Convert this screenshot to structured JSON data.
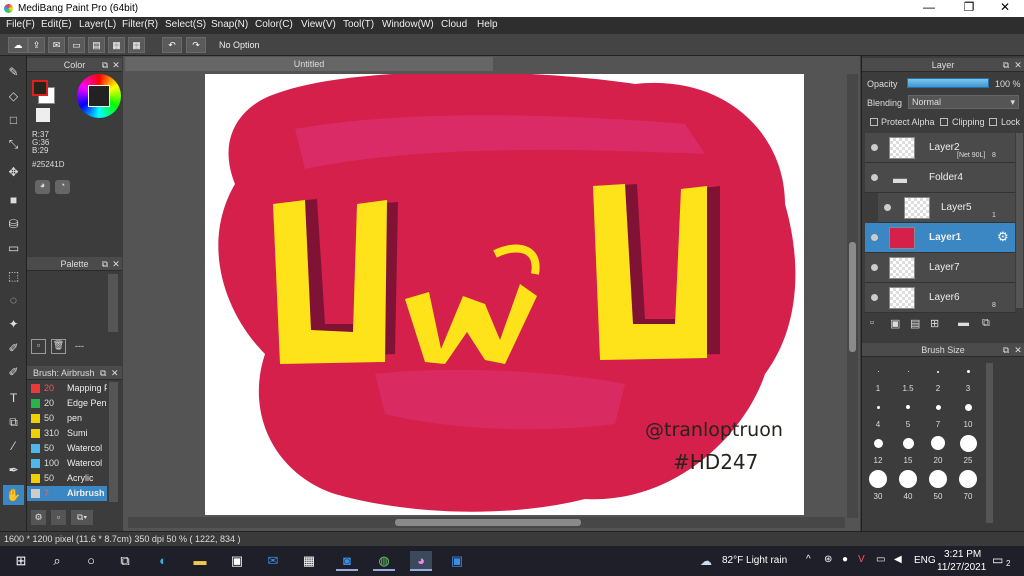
{
  "app": {
    "title": "MediBang Paint Pro (64bit)"
  },
  "window_controls": {
    "minimize": "—",
    "maximize": "❐",
    "close": "✕"
  },
  "menu": [
    "File(F)",
    "Edit(E)",
    "Layer(L)",
    "Filter(R)",
    "Select(S)",
    "Snap(N)",
    "Color(C)",
    "View(V)",
    "Tool(T)",
    "Window(W)",
    "Cloud",
    "Help"
  ],
  "toolbar": {
    "option_text": "No Option"
  },
  "document": {
    "tab_title": "Untitled"
  },
  "color_panel": {
    "title": "Color",
    "r": "R:37",
    "g": "G:36",
    "b": "B:29",
    "hex": "#25241D",
    "foreground": "#25241d",
    "background": "#ffffff",
    "accent_swatch": "#dd1f1f"
  },
  "palette_panel": {
    "title": "Palette",
    "footer": "---"
  },
  "brush_panel": {
    "title": "Brush: Airbrush",
    "items": [
      {
        "size": "20",
        "name": "Mapping P",
        "color": "#e83a3a"
      },
      {
        "size": "20",
        "name": "Edge Pen",
        "color": "#2bb24c"
      },
      {
        "size": "50",
        "name": "pen",
        "color": "#f0d000"
      },
      {
        "size": "310",
        "name": "Sumi",
        "color": "#f0d000"
      },
      {
        "size": "50",
        "name": "Watercol",
        "color": "#4fb8e8"
      },
      {
        "size": "100",
        "name": "Watercol",
        "color": "#4fb8e8"
      },
      {
        "size": "50",
        "name": "Acrylic",
        "color": "#f0d000"
      },
      {
        "size": "7",
        "name": "Airbrush",
        "color": "#cccccc"
      }
    ],
    "selected_index": 7
  },
  "canvas_art": {
    "main_text": "UwU",
    "signature": "@tranloptruon",
    "tag": "#HD247",
    "blob_color": "#d4204a",
    "letter_color": "#ffe31a"
  },
  "layer_panel": {
    "title": "Layer",
    "opacity_label": "Opacity",
    "opacity_value": "100 %",
    "blending_label": "Blending",
    "blending_value": "Normal",
    "protect_alpha": "Protect Alpha",
    "clipping": "Clipping",
    "lock": "Lock",
    "layers": [
      {
        "name": "Layer2",
        "badge": "[Net 90L]",
        "num": "8"
      },
      {
        "name": "Folder4",
        "badge": "",
        "num": ""
      },
      {
        "name": "Layer5",
        "badge": "",
        "num": "1"
      },
      {
        "name": "Layer1",
        "badge": "",
        "num": ""
      },
      {
        "name": "Layer7",
        "badge": "",
        "num": ""
      },
      {
        "name": "Layer6",
        "badge": "",
        "num": "8"
      }
    ]
  },
  "brush_size_panel": {
    "title": "Brush Size",
    "sizes": [
      "1",
      "1.5",
      "2",
      "3",
      "4",
      "5",
      "7",
      "10",
      "12",
      "15",
      "20",
      "25",
      "30",
      "40",
      "50",
      "70"
    ]
  },
  "status": {
    "text": "1600 * 1200 pixel   (11.6 * 8.7cm)   350 dpi   50 %   ( 1222, 834 )"
  },
  "taskbar": {
    "weather": "82°F  Light rain",
    "lang": "ENG",
    "time": "3:21 PM",
    "date": "11/27/2021",
    "notif": "2"
  }
}
